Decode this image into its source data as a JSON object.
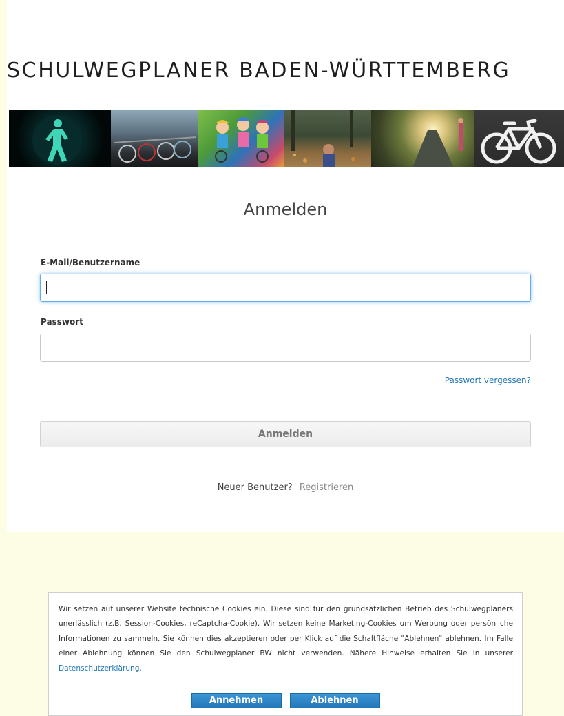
{
  "header": {
    "site_title": "SCHULWEGPLANER BADEN-WÜRTTEMBERG"
  },
  "banner": {
    "tiles": [
      {
        "icon": "traffic-light-figure-icon"
      },
      {
        "icon": "bicycle-rack-icon"
      },
      {
        "icon": "children-cycling-icon"
      },
      {
        "icon": "autumn-path-icon"
      },
      {
        "icon": "sunlit-path-icon"
      },
      {
        "icon": "bicycle-lane-icon"
      }
    ]
  },
  "login": {
    "heading": "Anmelden",
    "email_label": "E-Mail/Benutzername",
    "email_value": "",
    "password_label": "Passwort",
    "password_value": "",
    "forgot_password": "Passwort vergessen?",
    "submit_label": "Anmelden",
    "new_user_text": "Neuer Benutzer?",
    "register_link": "Registrieren"
  },
  "cookie_banner": {
    "text": "Wir setzen auf unserer Website technische Cookies ein. Diese sind für den grundsätzlichen Betrieb des Schulwegplaners unerlässlich (z.B. Session-Cookies, reCaptcha-Cookie). Wir setzen keine Marketing-Cookies um Werbung oder persönliche Informationen zu sammeln. Sie können dies akzeptieren oder per Klick auf die Schaltfläche \"Ablehnen\" ablehnen. Im Falle einer Ablehnung können Sie den Schulwegplaner BW nicht verwenden. Nähere Hinweise erhalten Sie in unserer",
    "privacy_link": "Datenschutzerklärung.",
    "accept_label": "Annehmen",
    "decline_label": "Ablehnen"
  },
  "colors": {
    "page_background": "#fdfde6",
    "link_blue": "#2378b5",
    "button_blue": "#2577b8",
    "focus_glow": "#66afe9"
  }
}
